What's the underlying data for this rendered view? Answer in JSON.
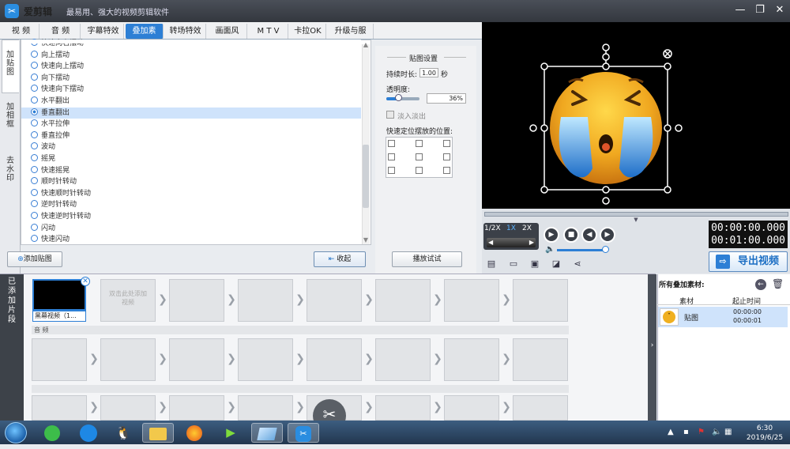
{
  "app": {
    "title": "爱剪辑",
    "slogan": "最易用、强大的视频剪辑软件",
    "logo_char": "✂"
  },
  "window_controls": {
    "minimize": "—",
    "maximize": "❐",
    "close": "✕"
  },
  "tabs": [
    "视 频",
    "音 频",
    "字幕特效",
    "叠加素材",
    "转场特效",
    "画面风格",
    "M T V",
    "卡拉OK",
    "升级与服务"
  ],
  "vertical_tabs": [
    "加贴图",
    "加相框",
    "去水印"
  ],
  "effects_list": {
    "items": [
      "快速向右摆动",
      "向上摆动",
      "快速向上摆动",
      "向下摆动",
      "快速向下摆动",
      "水平翻出",
      "垂直翻出",
      "水平拉伸",
      "垂直拉伸",
      "波动",
      "摇晃",
      "快速摇晃",
      "顺时针转动",
      "快速顺时针转动",
      "逆时针转动",
      "快速逆时针转动",
      "闪动",
      "快速闪动"
    ],
    "selected": "垂直翻出"
  },
  "list_buttons": {
    "add_sticker": "添加贴图",
    "collapse": "收起"
  },
  "settings": {
    "heading": "贴图设置",
    "duration_label": "持续时长:",
    "duration_value": "1.00",
    "duration_unit": "秒",
    "opacity_label": "透明度:",
    "opacity_value": "36%",
    "opacity_fraction": 0.36,
    "fade_label": "淡入淡出",
    "position_label": "快速定位摆放的位置:",
    "play_test": "播放试试"
  },
  "player": {
    "speeds": [
      "1/2X",
      "1X",
      "2X"
    ],
    "current_time": "00:00:00.000",
    "total_time": "00:01:00.000",
    "export_label": "导出视频",
    "controls": [
      "play",
      "stop",
      "prev-frame",
      "next-frame"
    ]
  },
  "timeline": {
    "side_label": "已添加片段",
    "first_clip_label": "黑幕视频（1...",
    "placeholder": "双击此处添加视频",
    "audio_track_label": "音 频"
  },
  "overlay_panel": {
    "title": "所有叠加素材:",
    "col_material": "素材",
    "col_time": "起止时间",
    "rows": [
      {
        "name": "贴图",
        "start": "00:00:00",
        "end": "00:00:01"
      }
    ]
  },
  "taskbar": {
    "time": "6:30",
    "date": "2019/6/25"
  },
  "colors": {
    "accent": "#2d7fd5",
    "titlebar": "#3c4048"
  }
}
